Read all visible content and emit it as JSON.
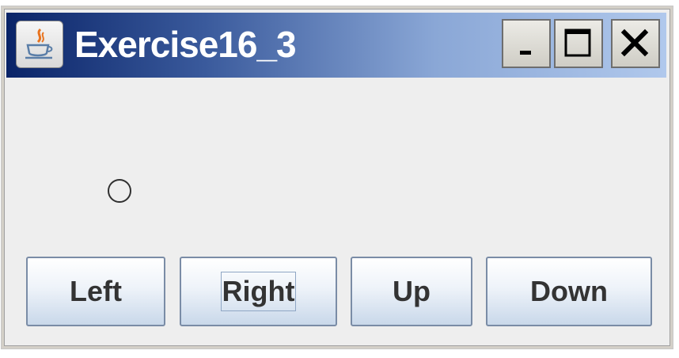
{
  "window": {
    "title": "Exercise16_3",
    "icon": "java-coffee-icon",
    "controls": {
      "minimize_icon": "minimize-icon",
      "maximize_icon": "maximize-icon",
      "close_icon": "close-icon"
    }
  },
  "buttons": {
    "left": "Left",
    "right": "Right",
    "up": "Up",
    "down": "Down",
    "focused": "Right"
  },
  "colors": {
    "titlebar_start": "#0a2468",
    "titlebar_end": "#b0c8ec",
    "content_bg": "#eeeeee"
  }
}
